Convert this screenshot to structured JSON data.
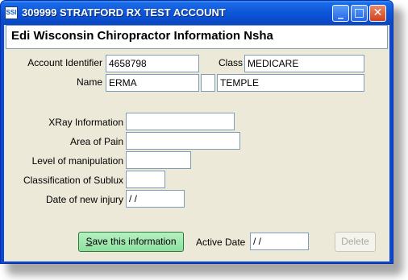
{
  "window": {
    "title": "309999 STRATFORD RX TEST ACCOUNT",
    "app_icon_text": "SSI",
    "minimize_glyph": "_",
    "maximize_glyph": "□",
    "close_glyph": "✕"
  },
  "header": {
    "title": "Edi Wisconsin Chiropractor Information Nsha"
  },
  "account": {
    "identifier_label": "Account Identifier",
    "identifier_value": "4658798",
    "class_label": "Class",
    "class_value": "MEDICARE",
    "name_label": "Name",
    "first_name": "ERMA",
    "middle_initial": "",
    "last_name": "TEMPLE"
  },
  "fields": {
    "xray_label": "XRay Information",
    "xray_value": "",
    "area_label": "Area of Pain",
    "area_value": "",
    "manipulation_label": "Level of manipulation",
    "manipulation_value": "",
    "sublux_label": "Classification of Sublux",
    "sublux_value": "",
    "injury_label": "Date of new injury",
    "injury_value": " / /"
  },
  "footer": {
    "save_label_first": "S",
    "save_label_rest": "ave this information",
    "active_date_label": "Active Date",
    "active_date_value": " / /",
    "delete_label": "Delete"
  }
}
